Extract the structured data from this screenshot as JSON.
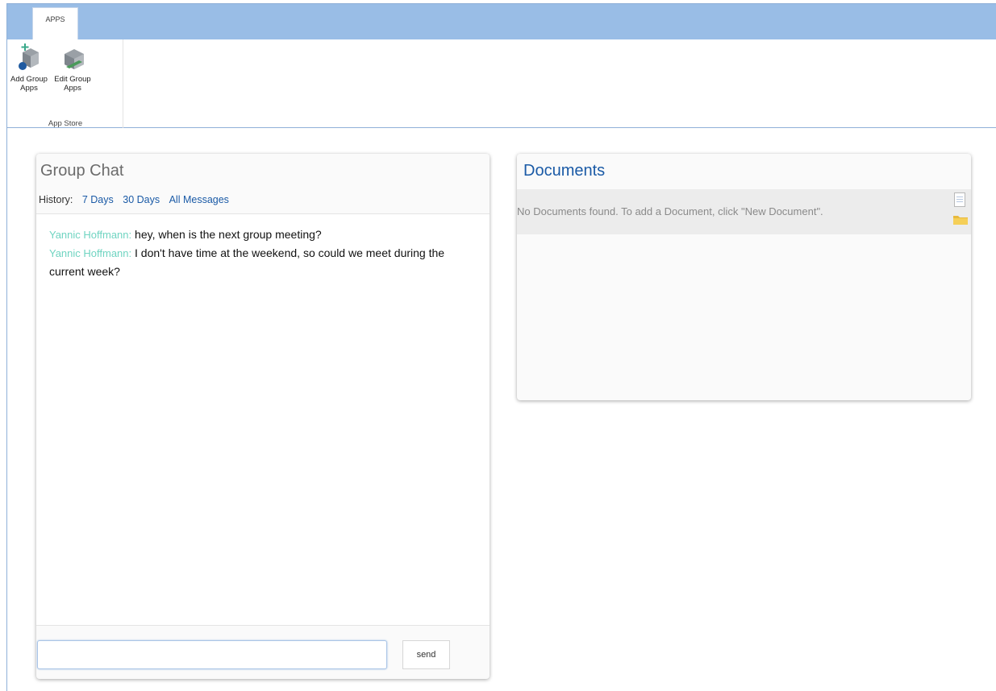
{
  "ribbon": {
    "tab_apps": "APPS",
    "buttons": {
      "add_group_apps": "Add Group Apps",
      "edit_group_apps": "Edit Group Apps"
    },
    "group_label": "App Store"
  },
  "chat": {
    "title": "Group Chat",
    "history_label": "History:",
    "history_links": {
      "days7": "7 Days",
      "days30": "30 Days",
      "all": "All Messages"
    },
    "messages": [
      {
        "author": "Yannic Hoffmann:",
        "text": "hey, when is the next group meeting?"
      },
      {
        "author": "Yannic Hoffmann:",
        "text": "I don't have time at the weekend, so could we meet during the current week?"
      }
    ],
    "input_value": "",
    "send_label": "send"
  },
  "documents": {
    "title": "Documents",
    "empty_message": "No Documents found. To add a Document, click \"New Document\".",
    "icons": [
      "new-document-icon",
      "folder-icon"
    ]
  },
  "colors": {
    "tab_bar": "#99bde6",
    "link": "#1a5aa6",
    "author": "#6fd4c1"
  }
}
